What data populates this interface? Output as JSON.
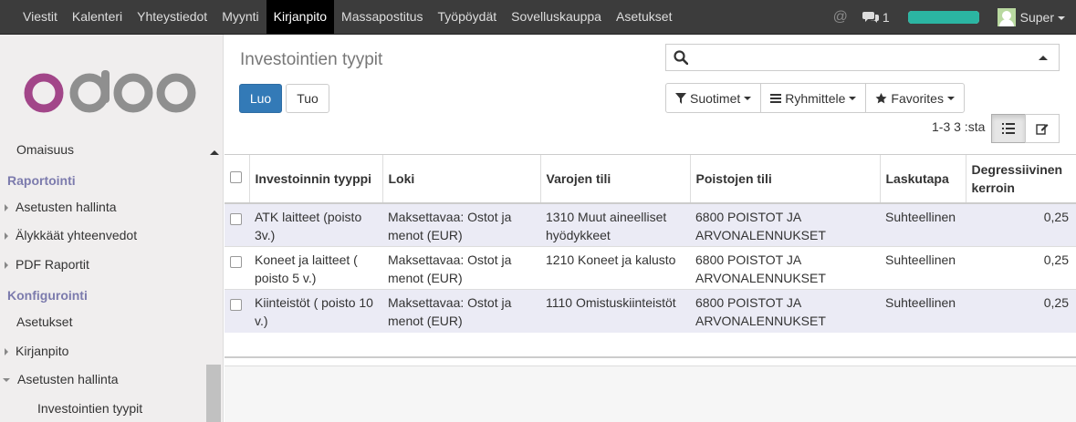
{
  "topnav": {
    "items": [
      "Viestit",
      "Kalenteri",
      "Yhteystiedot",
      "Myynti",
      "Kirjanpito",
      "Massapostitus",
      "Työpöydät",
      "Sovelluskauppa",
      "Asetukset"
    ],
    "active": "Kirjanpito",
    "chat_count": "1",
    "user_name": "Super",
    "progress_fraction": 1.0
  },
  "sidebar": {
    "logo_text": "odoo",
    "items": {
      "omaisuus": "Omaisuus",
      "raportointi": "Raportointi",
      "asetusten_hallinta": "Asetusten hallinta",
      "alykkaat": "Älykkäät yhteenvedot",
      "pdf": "PDF Raportit",
      "konfigurointi": "Konfigurointi",
      "asetukset": "Asetukset",
      "kirjanpito": "Kirjanpito",
      "asetusten_hallinta2": "Asetusten hallinta",
      "investointien_tyypit": "Investointien tyypit"
    }
  },
  "control": {
    "title": "Investointien tyypit",
    "create_label": "Luo",
    "import_label": "Tuo",
    "search_placeholder": "",
    "filters_label": "Suotimet",
    "group_label": "Ryhmittele",
    "favorites_label": "Favorites",
    "pager": "1-3 3 :sta"
  },
  "table": {
    "headers": [
      "Investoinnin tyyppi",
      "Loki",
      "Varojen tili",
      "Poistojen tili",
      "Laskutapa",
      "Degressiivinen kerroin"
    ],
    "rows": [
      [
        "ATK laitteet (poisto 3v.)",
        "Maksettavaa: Ostot ja menot (EUR)",
        "1310 Muut aineelliset hyödykkeet",
        "6800 POISTOT JA ARVONALENNUKSET",
        "Suhteellinen",
        "0,25"
      ],
      [
        "Koneet ja laitteet ( poisto 5 v.)",
        "Maksettavaa: Ostot ja menot (EUR)",
        "1210 Koneet ja kalusto",
        "6800 POISTOT JA ARVONALENNUKSET",
        "Suhteellinen",
        "0,25"
      ],
      [
        "Kiinteistöt ( poisto 10 v.)",
        "Maksettavaa: Ostot ja menot (EUR)",
        "1110 Omistuskiinteistöt",
        "6800 POISTOT JA ARVONALENNUKSET",
        "Suhteellinen",
        "0,25"
      ]
    ]
  },
  "colors": {
    "topbar": "#3c3c3c",
    "primary": "#337ab7",
    "section": "#7c7bad",
    "row_stripe": "#ebebf5"
  }
}
